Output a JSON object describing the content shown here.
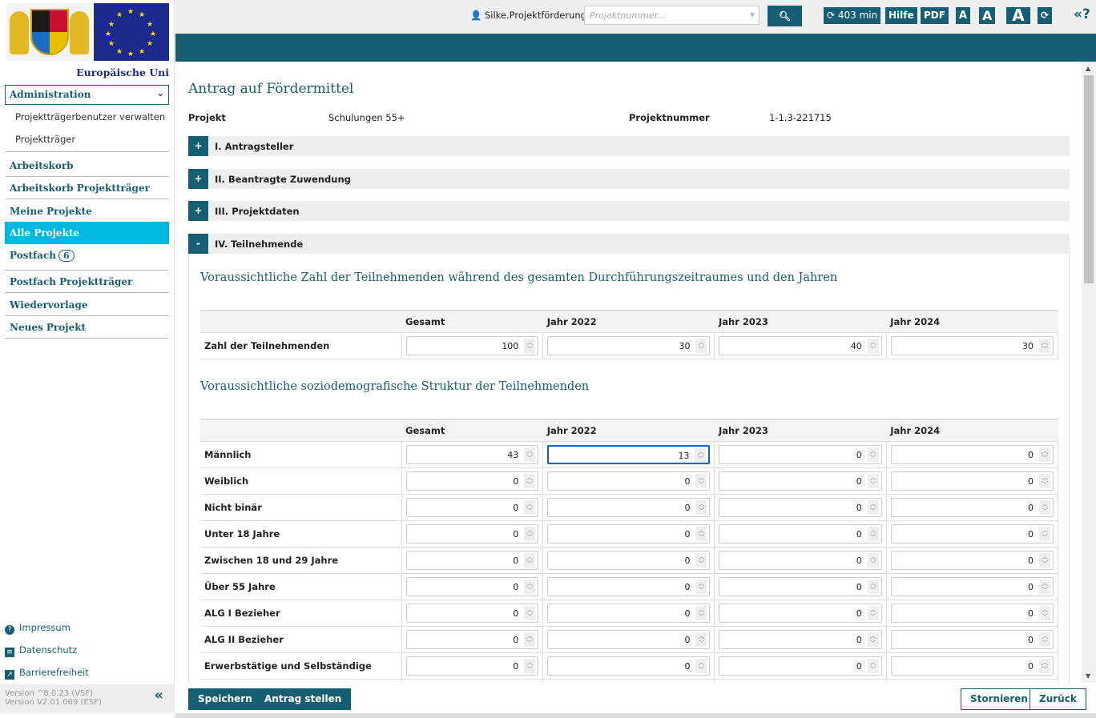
{
  "header": {
    "user": "Silke.Projektförderung",
    "search_placeholder": "Projektnummer...",
    "session": "403 min",
    "help": "Hilfe",
    "pdf": "PDF",
    "font_small": "A",
    "font_medium": "A",
    "font_large": "A",
    "help_icon": "«?"
  },
  "sidebar": {
    "eu_label": "Europäische Uni",
    "admin_select": "Administration",
    "subitems": [
      "Projektträgerbenutzer verwalten",
      "Projektträger"
    ],
    "items": [
      {
        "label": "Arbeitskorb"
      },
      {
        "label": "Arbeitskorb Projektträger"
      },
      {
        "label": "Meine Projekte"
      },
      {
        "label": "Alle Projekte",
        "active": true
      },
      {
        "label": "Postfach",
        "badge": "6"
      },
      {
        "label": "Postfach Projektträger"
      },
      {
        "label": "Wiedervorlage"
      },
      {
        "label": "Neues Projekt"
      }
    ],
    "footer": [
      "Impressum",
      "Datenschutz",
      "Barrierefreiheit"
    ],
    "version1": "Version ^8.0.23 (VSF)",
    "version2": "Version V2.01.069 (ESF)"
  },
  "colors": {
    "primary": "#155e73",
    "active": "#00b7e2",
    "focus": "#0a63d1"
  },
  "main": {
    "title": "Antrag auf Fördermittel",
    "projekt_label": "Projekt",
    "projekt_value": "Schulungen 55+",
    "nummer_label": "Projektnummer",
    "nummer_value": "1-1.3-221715",
    "sections": [
      {
        "sign": "+",
        "title": "I. Antragsteller"
      },
      {
        "sign": "+",
        "title": "II. Beantragte Zuwendung"
      },
      {
        "sign": "+",
        "title": "III. Projektdaten"
      },
      {
        "sign": "-",
        "title": "IV. Teilnehmende"
      }
    ],
    "heading1": "Voraussichtliche Zahl der Teilnehmenden während des gesamten Durchführungszeitraumes und den Jahren",
    "heading2": "Voraussichtliche soziodemografische Struktur der Teilnehmenden",
    "columns": [
      "Gesamt",
      "Jahr 2022",
      "Jahr 2023",
      "Jahr 2024"
    ],
    "table1": [
      {
        "label": "Zahl der Teilnehmenden",
        "values": [
          "100",
          "30",
          "40",
          "30"
        ]
      }
    ],
    "table2": [
      {
        "label": "Männlich",
        "values": [
          "43",
          "13",
          "0",
          "0"
        ]
      },
      {
        "label": "Weiblich",
        "values": [
          "0",
          "0",
          "0",
          "0"
        ]
      },
      {
        "label": "Nicht binär",
        "values": [
          "0",
          "0",
          "0",
          "0"
        ]
      },
      {
        "label": "Unter 18 Jahre",
        "values": [
          "0",
          "0",
          "0",
          "0"
        ]
      },
      {
        "label": "Zwischen 18 und 29 Jahre",
        "values": [
          "0",
          "0",
          "0",
          "0"
        ]
      },
      {
        "label": "Über 55 Jahre",
        "values": [
          "0",
          "0",
          "0",
          "0"
        ]
      },
      {
        "label": "ALG I Bezieher",
        "values": [
          "0",
          "0",
          "0",
          "0"
        ]
      },
      {
        "label": "ALG II Bezieher",
        "values": [
          "0",
          "0",
          "0",
          "0"
        ]
      },
      {
        "label": "Erwerbstätige und Selbständige",
        "values": [
          "0",
          "0",
          "0",
          "0"
        ]
      },
      {
        "label": "",
        "values": [
          "",
          "",
          "",
          ""
        ]
      }
    ]
  },
  "footer_buttons": {
    "save": "Speichern",
    "submit": "Antrag stellen",
    "cancel": "Stornieren",
    "back": "Zurück"
  }
}
